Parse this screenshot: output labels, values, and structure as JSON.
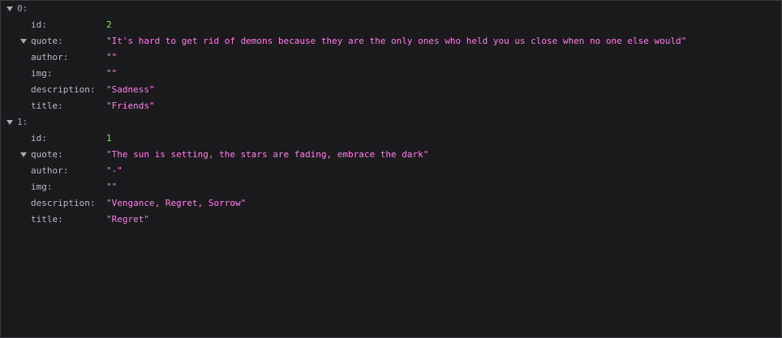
{
  "entries": [
    {
      "index_label": "0:",
      "fields": [
        {
          "key": "id:",
          "value": "2",
          "type": "number"
        },
        {
          "key": "quote:",
          "value": "\"It's hard to get rid of demons because they are the only ones who held you us close when no one else would\"",
          "type": "string",
          "expandable": true
        },
        {
          "key": "author:",
          "value": "\"\"",
          "type": "string"
        },
        {
          "key": "img:",
          "value": "\"\"",
          "type": "string"
        },
        {
          "key": "description:",
          "value": "\"Sadness\"",
          "type": "string"
        },
        {
          "key": "title:",
          "value": "\"Friends\"",
          "type": "string"
        }
      ]
    },
    {
      "index_label": "1:",
      "fields": [
        {
          "key": "id:",
          "value": "1",
          "type": "number"
        },
        {
          "key": "quote:",
          "value": "\"The sun is setting, the stars are fading, embrace the dark\"",
          "type": "string",
          "expandable": true
        },
        {
          "key": "author:",
          "value": "\"-\"",
          "type": "string"
        },
        {
          "key": "img:",
          "value": "\"\"",
          "type": "string"
        },
        {
          "key": "description:",
          "value": "\"Vengance, Regret, Sorrow\"",
          "type": "string"
        },
        {
          "key": "title:",
          "value": "\"Regret\"",
          "type": "string"
        }
      ]
    }
  ],
  "colors": {
    "background": "#1b1b1d",
    "key": "#b6bac3",
    "number": "#86de74",
    "string": "#ff7de9",
    "toggle": "#a9a9ae"
  }
}
